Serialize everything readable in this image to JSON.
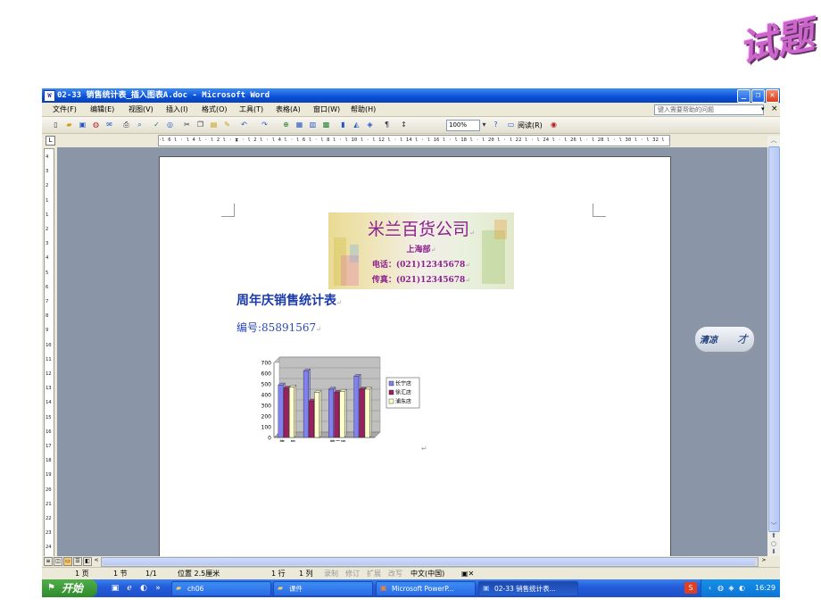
{
  "slide": {
    "title": "试题"
  },
  "window": {
    "title": "02-33 销售统计表_插入图表A.doc - Microsoft Word",
    "app_icon": "W",
    "controls": {
      "minimize": "_",
      "restore": "❐",
      "close": "✕"
    }
  },
  "menu": {
    "items": [
      "文件(F)",
      "编辑(E)",
      "视图(V)",
      "插入(I)",
      "格式(O)",
      "工具(T)",
      "表格(A)",
      "窗口(W)",
      "帮助(H)"
    ],
    "help_placeholder": "键入需要帮助的问题",
    "help_close": "×"
  },
  "toolbar": {
    "zoom": "100%",
    "read_label": "阅读(R)"
  },
  "ruler": {
    "corner": "L",
    "horizontal": "·l 6 l · l 4 l · l 2 l · ⧗ · l 2 l · l 4 l · l 6 l · l 8 l · l 10 l · l 12 l · l 14 l · l 16 l · l 18 l · l 20 l · l 22 l · l 24 l · l 26 l · l 28 l · l 30 l · l 32 l · l 34 ⌂ · l 36 l · l 38 l · l 40 l · l 42",
    "vertical": [
      "4",
      "3",
      "2",
      "1",
      "1",
      "2",
      "3",
      "4",
      "5",
      "6",
      "7",
      "8",
      "9",
      "10",
      "11",
      "12",
      "13",
      "14",
      "15",
      "16",
      "17",
      "18",
      "19",
      "20",
      "21",
      "22",
      "23",
      "24"
    ]
  },
  "document": {
    "company_name": "米兰百货公司",
    "branch": "上海部",
    "phone": "电话：(021)12345678",
    "fax": "传真：(021)12345678",
    "heading": "周年庆销售统计表",
    "number": "编号:85891567",
    "para_mark": "↵"
  },
  "chart_data": {
    "type": "bar",
    "categories": [
      "第一周",
      "第二周",
      "第三周",
      "第四周"
    ],
    "x_tick_labels": [
      "第一周",
      "第三周"
    ],
    "series": [
      {
        "name": "长宁店",
        "values": [
          490,
          620,
          450,
          570
        ],
        "color": "#8080f0"
      },
      {
        "name": "徐汇店",
        "values": [
          460,
          340,
          420,
          450
        ],
        "color": "#9a2060"
      },
      {
        "name": "浦东店",
        "values": [
          470,
          420,
          430,
          450
        ],
        "color": "#ffffcc"
      }
    ],
    "ylim": [
      0,
      700
    ],
    "yticks": [
      0,
      100,
      200,
      300,
      400,
      500,
      600,
      700
    ],
    "legend_position": "right",
    "three_d": true
  },
  "scrollbar": {
    "up": "︿",
    "down": "﹀",
    "prev": "⬆",
    "select": "○",
    "next": "⬇",
    "left": "<",
    "right": ">"
  },
  "status": {
    "page": "1 页",
    "section": "1 节",
    "pages": "1/1",
    "position": "位置 2.5厘米",
    "line": "1 行",
    "col": "1 列",
    "rec": "录制",
    "trk": "修订",
    "ext": "扩展",
    "ovr": "改写",
    "lang": "中文(中国)"
  },
  "taskbar": {
    "start_label": "开始",
    "items": [
      {
        "label": "ch06",
        "icon": "folder-icon"
      },
      {
        "label": "课件",
        "icon": "folder-icon"
      },
      {
        "label": "Microsoft PowerP...",
        "icon": "powerpoint-icon"
      },
      {
        "label": "02-33 销售统计表...",
        "icon": "word-icon"
      }
    ],
    "ime": "S",
    "clock": "16:29"
  },
  "nav_badge": {
    "left": "清凉",
    "right": "才"
  }
}
